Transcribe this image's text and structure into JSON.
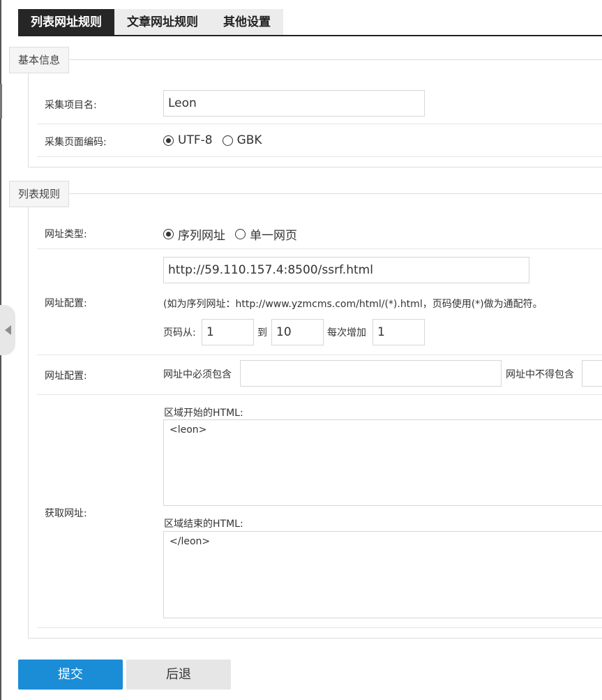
{
  "tabs": [
    {
      "label": "列表网址规则",
      "active": true
    },
    {
      "label": "文章网址规则",
      "active": false
    },
    {
      "label": "其他设置",
      "active": false
    }
  ],
  "basic": {
    "legend": "基本信息",
    "project_name_label": "采集项目名:",
    "project_name_value": "Leon",
    "encoding_label": "采集页面编码:",
    "encoding_options": [
      "UTF-8",
      "GBK"
    ],
    "encoding_selected": "UTF-8"
  },
  "list_rules": {
    "legend": "列表规则",
    "url_type_label": "网址类型:",
    "url_type_options": [
      "序列网址",
      "单一网页"
    ],
    "url_type_selected": "序列网址",
    "url_config_label": "网址配置:",
    "url_value": "http://59.110.157.4:8500/ssrf.html",
    "hint": "(如为序列网址：http://www.yzmcms.com/html/(*).html，页码使用(*)做为通配符。",
    "page_from_label": "页码从:",
    "page_from_value": "1",
    "page_to_label": "到",
    "page_to_value": "10",
    "page_step_label": "每次增加",
    "page_step_value": "1",
    "url_config2_label": "网址配置:",
    "must_contain_label": "网址中必须包含",
    "must_contain_value": "",
    "must_not_contain_label": "网址中不得包含",
    "must_not_contain_value": "",
    "fetch_label": "获取网址:",
    "start_html_label": "区域开始的HTML:",
    "start_html_value": "<leon>",
    "end_html_label": "区域结束的HTML:",
    "end_html_value": "</leon>"
  },
  "buttons": {
    "submit": "提交",
    "back": "后退"
  }
}
